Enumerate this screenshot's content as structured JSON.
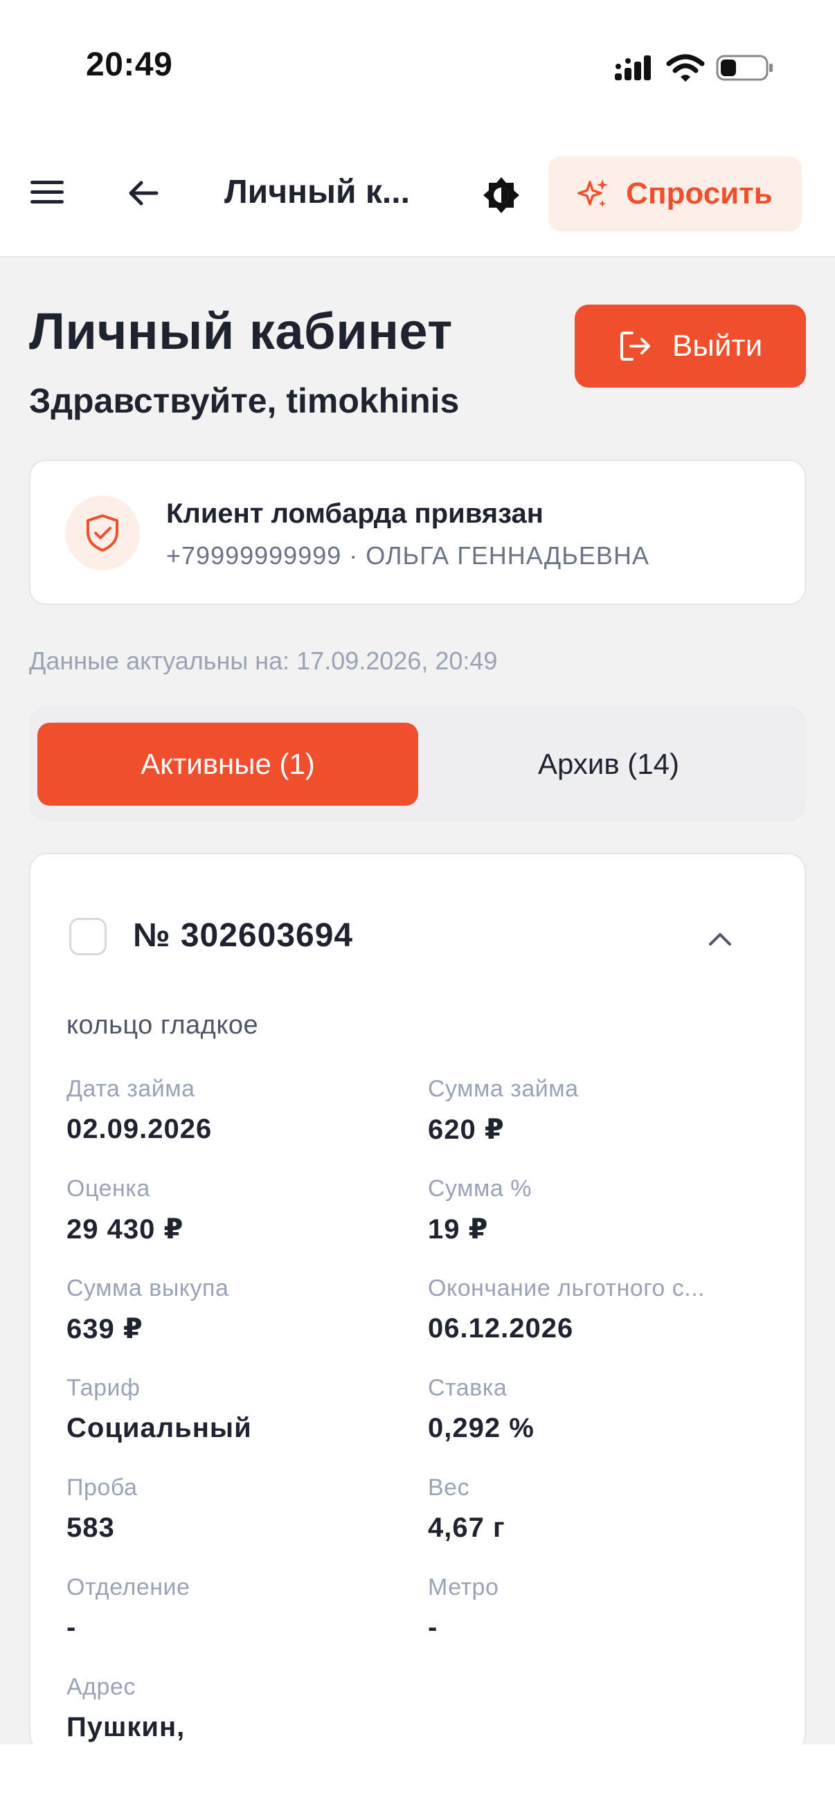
{
  "status_bar": {
    "time": "20:49",
    "icons": [
      "signal-icon",
      "wifi-icon",
      "battery-icon"
    ]
  },
  "header": {
    "title": "Личный к...",
    "ask_label": "Спросить",
    "icons": [
      "menu-icon",
      "back-arrow-icon",
      "theme-toggle-icon",
      "sparkle-icon"
    ]
  },
  "page": {
    "title": "Личный кабинет",
    "greeting": "Здравствуйте, timokhinis",
    "logout_label": "Выйти"
  },
  "client": {
    "title": "Клиент ломбарда привязан",
    "subtitle": "+79999999999 · ОЛЬГА ГЕННАДЬЕВНА"
  },
  "updated_text": "Данные актуальны на: 17.09.2026, 20:49",
  "tabs": [
    {
      "label": "Активные (1)",
      "active": true
    },
    {
      "label": "Архив (14)",
      "active": false
    }
  ],
  "loan": {
    "number": "№ 302603694",
    "item": "кольцо гладкое",
    "fields": [
      {
        "label": "Дата займа",
        "value": "02.09.2026"
      },
      {
        "label": "Сумма займа",
        "value": "620 ₽"
      },
      {
        "label": "Оценка",
        "value": "29 430 ₽"
      },
      {
        "label": "Сумма %",
        "value": "19 ₽"
      },
      {
        "label": "Сумма выкупа",
        "value": "639 ₽"
      },
      {
        "label": "Окончание льготного с...",
        "value": "06.12.2026"
      },
      {
        "label": "Тариф",
        "value": "Социальный"
      },
      {
        "label": "Ставка",
        "value": "0,292 %"
      },
      {
        "label": "Проба",
        "value": "583"
      },
      {
        "label": "Вес",
        "value": "4,67 г"
      },
      {
        "label": "Отделение",
        "value": "-"
      },
      {
        "label": "Метро",
        "value": "-"
      },
      {
        "label": "Адрес",
        "value": "Пушкин,"
      }
    ]
  },
  "colors": {
    "accent": "#ef4f2d",
    "accent_light": "#fdeee8",
    "text": "#1f2330",
    "muted": "#9aa3b5",
    "background": "#f2f2f3"
  }
}
